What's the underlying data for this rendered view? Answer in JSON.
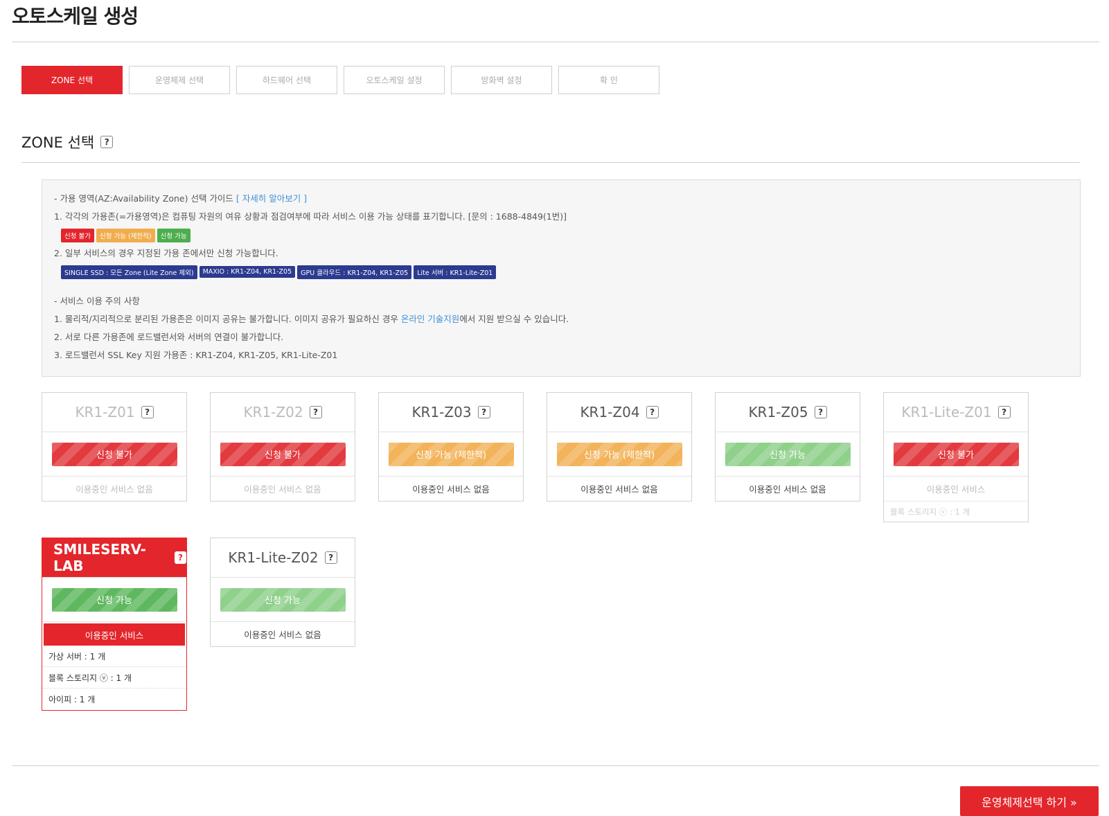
{
  "page": {
    "title": "오토스케일 생성"
  },
  "steps": [
    {
      "label": "ZONE 선택",
      "active": true
    },
    {
      "label": "운영체제 선택",
      "active": false
    },
    {
      "label": "하드웨어 선택",
      "active": false
    },
    {
      "label": "오토스케일 설정",
      "active": false
    },
    {
      "label": "방화벽 설정",
      "active": false
    },
    {
      "label": "확   인",
      "active": false
    }
  ],
  "section": {
    "title": "ZONE 선택",
    "help": "?"
  },
  "guide": {
    "line1_prefix": "- 가용 영역(AZ:Availability Zone) 선택 가이드 ",
    "line1_link": "[ 자세히 알아보기 ]",
    "line2": "1. 각각의 가용존(=가용영역)은 컴퓨팅 자원의 여유 상황과 점검여부에 따라 서비스 이용 가능 상태를 표기합니다. [문의 : 1688-4849(1번)]",
    "status_tags": [
      "신청 불가",
      "신청 가능 (제한적)",
      "신청 가능"
    ],
    "line3": "2. 일부 서비스의 경우 지정된 가용 존에서만 신청 가능합니다.",
    "service_tags": [
      "SINGLE SSD : 모든 Zone (Lite Zone 제외)",
      "MAXIO : KR1-Z04, KR1-Z05",
      "GPU 클라우드 : KR1-Z04, KR1-Z05",
      "Lite 서버 : KR1-Lite-Z01"
    ],
    "line4": "- 서비스 이용 주의 사항",
    "line5_prefix": "1. 물리적/지리적으로 분리된 가용존은 이미지 공유는 불가합니다. 이미지 공유가 필요하신 경우 ",
    "line5_link": "온라인 기술지원",
    "line5_suffix": "에서 지원 받으실 수 있습니다.",
    "line6": "2. 서로 다른 가용존에 로드밸런서와 서버의 연결이 불가합니다.",
    "line7": "3. 로드밸런서 SSL Key 지원 가용존 : KR1-Z04, KR1-Z05, KR1-Lite-Z01"
  },
  "zones": [
    {
      "name": "KR1-Z01",
      "help": "?",
      "status": "신청 불가",
      "footer": "이용중인 서비스 없음"
    },
    {
      "name": "KR1-Z02",
      "help": "?",
      "status": "신청 불가",
      "footer": "이용중인 서비스 없음"
    },
    {
      "name": "KR1-Z03",
      "help": "?",
      "status": "신청 가능 (제한적)",
      "footer": "이용중인 서비스 없음"
    },
    {
      "name": "KR1-Z04",
      "help": "?",
      "status": "신청 가능 (제한적)",
      "footer": "이용중인 서비스 없음"
    },
    {
      "name": "KR1-Z05",
      "help": "?",
      "status": "신청 가능",
      "footer": "이용중인 서비스 없음"
    },
    {
      "name": "KR1-Lite-Z01",
      "help": "?",
      "status": "신청 불가",
      "footer": "이용중인 서비스",
      "extra": "블록 스토리지 ⓥ : 1 개"
    },
    {
      "name": "SMILESERV-LAB",
      "help": "?",
      "status": "신청 가능",
      "footer": "이용중인 서비스",
      "services": [
        "가상 서버 : 1 개",
        "블록 스토리지 ⓥ : 1 개",
        "아이피 : 1 개"
      ]
    },
    {
      "name": "KR1-Lite-Z02",
      "help": "?",
      "status": "신청 가능",
      "footer": "이용중인 서비스 없음"
    }
  ],
  "next_button": {
    "label": "운영체제선택 하기 »"
  }
}
